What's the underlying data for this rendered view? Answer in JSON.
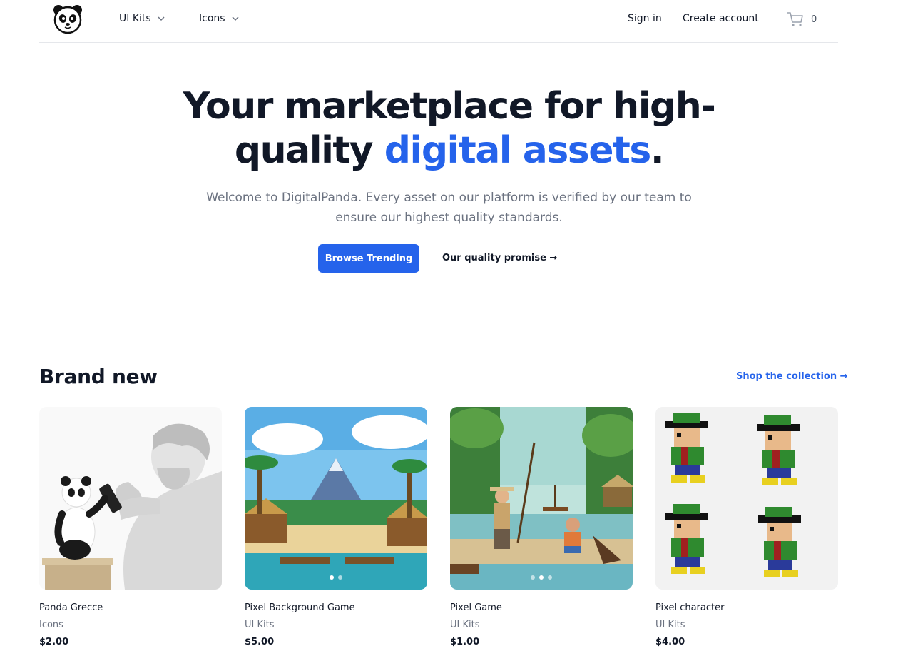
{
  "header": {
    "logo_alt": "panda-logo",
    "nav": [
      {
        "label": "UI Kits"
      },
      {
        "label": "Icons"
      }
    ],
    "sign_in": "Sign in",
    "create_account": "Create account",
    "cart_count": "0"
  },
  "hero": {
    "title_line1": "Your marketplace for high-",
    "title_line2_plain": "quality ",
    "title_line2_accent": "digital assets",
    "title_period": ".",
    "subtitle_line1": "Welcome to DigitalPanda. Every asset on our platform is verified by our team to",
    "subtitle_line2": "ensure our highest quality standards.",
    "primary_button": "Browse Trending",
    "secondary_link": "Our quality promise →"
  },
  "section": {
    "title": "Brand new",
    "shop_link": "Shop the collection →"
  },
  "products": [
    {
      "name": "Panda Grecce",
      "category": "Icons",
      "price": "$2.00"
    },
    {
      "name": "Pixel Background Game",
      "category": "UI Kits",
      "price": "$5.00"
    },
    {
      "name": "Pixel Game",
      "category": "UI Kits",
      "price": "$1.00"
    },
    {
      "name": "Pixel character",
      "category": "UI Kits",
      "price": "$4.00"
    }
  ],
  "colors": {
    "accent": "#2563eb",
    "text": "#111827",
    "muted": "#6b7280"
  }
}
